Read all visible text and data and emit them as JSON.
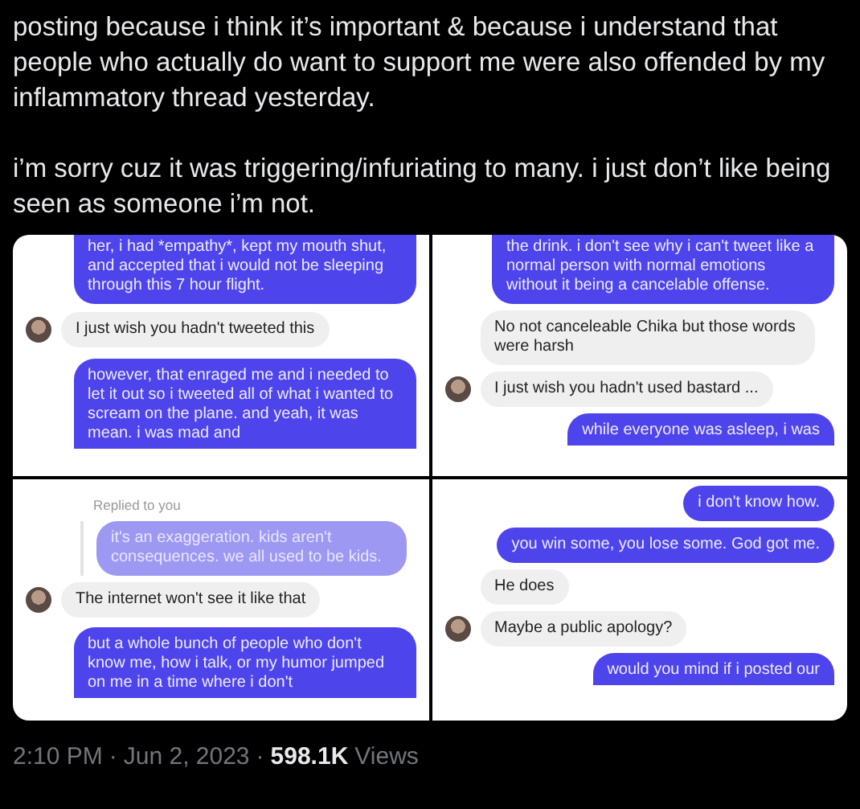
{
  "tweet": {
    "paragraphs": [
      "posting because i think it’s important & because i understand that people who actually do want to support me were also offended by my inflammatory thread yesterday.",
      "i’m sorry cuz it was triggering/infuriating to many. i just don’t like being seen as someone i’m not."
    ]
  },
  "panels": [
    {
      "messages": [
        {
          "kind": "sent",
          "text": "her, i had *empathy*, kept my mouth shut, and accepted that i would not be sleeping through this 7 hour flight."
        },
        {
          "kind": "received",
          "text": "I just wish you hadn't tweeted this",
          "avatar": true
        },
        {
          "kind": "sent",
          "text": "however, that enraged me and i needed to let it out so i tweeted all of what i wanted to scream on the plane. and yeah, it was mean. i was mad and"
        }
      ]
    },
    {
      "messages": [
        {
          "kind": "sent",
          "text": "the drink. i don't see why i can't tweet like a normal person with normal emotions without it being a cancelable offense."
        },
        {
          "kind": "received",
          "text": "No not canceleable Chika but those words were harsh",
          "avatar": false
        },
        {
          "kind": "received",
          "text": "I just wish you hadn't used bastard ...",
          "avatar": true
        },
        {
          "kind": "sent",
          "text": "while everyone was asleep, i was"
        }
      ]
    },
    {
      "messages": [
        {
          "kind": "reply_label",
          "text": "Replied to you"
        },
        {
          "kind": "quote",
          "text": "it's an exaggeration. kids aren't consequences. we all used to be kids."
        },
        {
          "kind": "received",
          "text": "The internet won't see it like that",
          "avatar": true
        },
        {
          "kind": "sent",
          "text": "but a whole bunch of people who don't know me, how i talk, or my humor jumped on me in a time where i don't"
        }
      ]
    },
    {
      "messages": [
        {
          "kind": "sent",
          "text": "i don't know how."
        },
        {
          "kind": "sent",
          "text": "you win some, you lose some. God got me."
        },
        {
          "kind": "received",
          "text": "He does",
          "avatar": false
        },
        {
          "kind": "received",
          "text": "Maybe a public apology?",
          "avatar": true
        },
        {
          "kind": "sent",
          "text": "would you mind if i posted our"
        }
      ]
    }
  ],
  "meta": {
    "time": "2:10 PM",
    "separator": "·",
    "date": "Jun 2, 2023",
    "views_count": "598.1K",
    "views_label": "Views"
  }
}
